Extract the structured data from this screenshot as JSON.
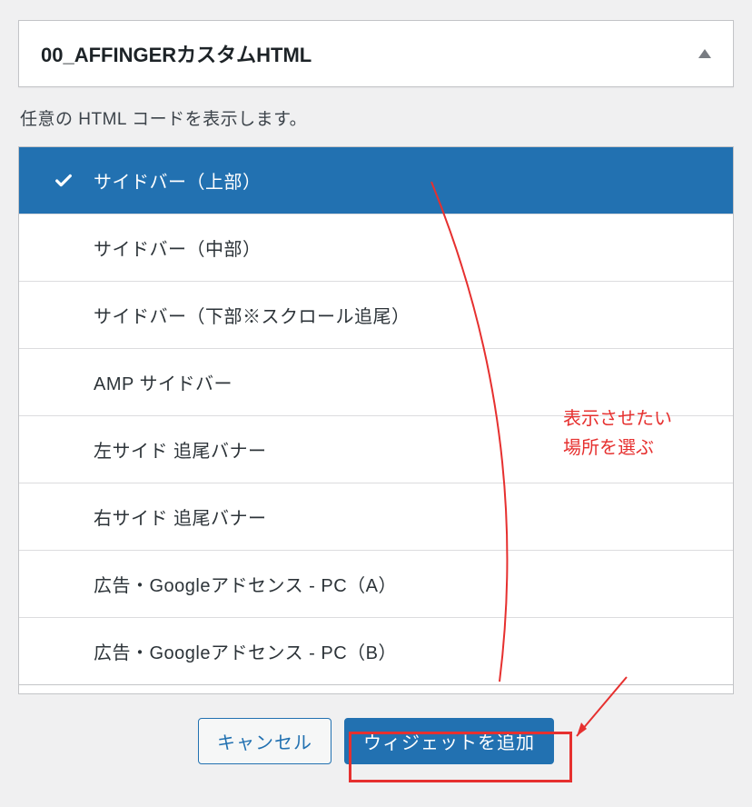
{
  "widget": {
    "title": "00_AFFINGERカスタムHTML",
    "description": "任意の HTML コードを表示します。"
  },
  "locations": {
    "items": [
      {
        "label": "サイドバー（上部）",
        "selected": true
      },
      {
        "label": "サイドバー（中部）",
        "selected": false
      },
      {
        "label": "サイドバー（下部※スクロール追尾）",
        "selected": false
      },
      {
        "label": "AMP サイドバー",
        "selected": false
      },
      {
        "label": "左サイド 追尾バナー",
        "selected": false
      },
      {
        "label": "右サイド 追尾バナー",
        "selected": false
      },
      {
        "label": "広告・Googleアドセンス - PC（A）",
        "selected": false
      },
      {
        "label": "広告・Googleアドセンス - PC（B）",
        "selected": false
      }
    ]
  },
  "buttons": {
    "cancel": "キャンセル",
    "add": "ウィジェットを追加"
  },
  "annotations": {
    "choose_location": "表示させたい\n場所を選ぶ"
  }
}
